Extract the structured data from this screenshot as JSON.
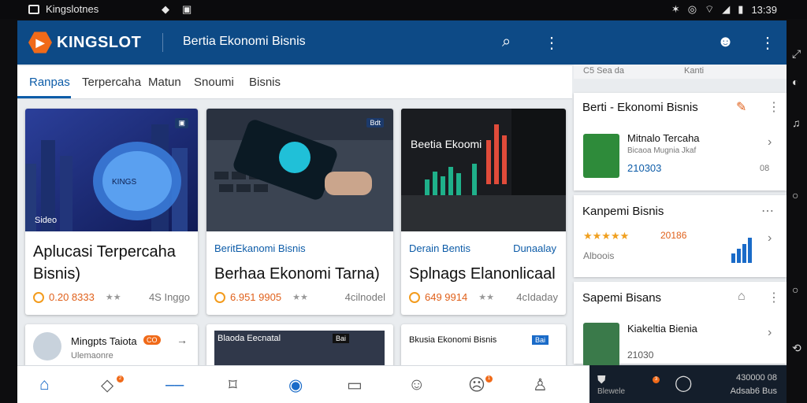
{
  "status_bar": {
    "app_name": "Kingslotnes",
    "time": "13:39",
    "icons": [
      "notification-icon",
      "bluetooth-icon",
      "alarm-icon",
      "wifi-icon",
      "signal-icon",
      "battery-icon"
    ]
  },
  "app_bar": {
    "logo": "KINGSLOT",
    "title": "Bertia Ekonomi Bisnis",
    "icons": [
      "search-icon",
      "more-vert-icon",
      "user-icon",
      "more-vert-icon"
    ]
  },
  "tabs": [
    {
      "label": "Ranpas",
      "active": true
    },
    {
      "label": "Terpercaha",
      "active": false
    },
    {
      "label": "Matun",
      "active": false
    },
    {
      "label": "Snoumi",
      "active": false
    },
    {
      "label": "Bisnis",
      "active": false
    }
  ],
  "cards": [
    {
      "badge": "",
      "image_label": "Sideo",
      "image_text": "KINGS",
      "category": "",
      "category_right": "",
      "title": "Aplucasi Terpercaha Bisnis)",
      "value": "0.20 8333",
      "right": "4S Inggo"
    },
    {
      "badge": "Bdt",
      "category": "BeritEkanomi Bisnis",
      "category_right": "",
      "title": "Berhaa Ekonomi Tarna)",
      "value": "6.951 9905",
      "right": "4cilnodel"
    },
    {
      "badge": "",
      "image_title": "Beetia Ekoomi",
      "category": "Derain Bentis",
      "category_right": "Dunaalay",
      "title": "Splnags Elanonlicaal",
      "value": "649 9914",
      "right": "4cIdaday"
    }
  ],
  "row2": [
    {
      "title": "Mingpts Taiota",
      "subtitle": "Ulemaonre",
      "badge": "CO"
    },
    {
      "title": "Blaoda Eecnatal",
      "badge": "Bai"
    },
    {
      "title": "Bkusia Ekonomi Bisnis",
      "badge": "Bai"
    }
  ],
  "side": {
    "top_row": {
      "left": "C5 Sea da",
      "right": "Kanti"
    },
    "card1": {
      "title": "Berti - Ekonomi Bisnis",
      "item_title": "Mitnalo Tercaha",
      "item_sub": "Bicaoa Mugnia Jkaf",
      "code": "210303",
      "right": "08"
    },
    "card2": {
      "title": "Kanpemi Bisnis",
      "rating": "20186",
      "sub": "Alboois"
    },
    "card3": {
      "title": "Sapemi Bisans",
      "item_title": "Kiakeltia Bienia",
      "code": "21030"
    }
  },
  "bottom_nav": [
    {
      "name": "home-icon"
    },
    {
      "name": "tag-icon",
      "badge": "2"
    },
    {
      "name": "minus-icon"
    },
    {
      "name": "bookmark-icon"
    },
    {
      "name": "globe-icon"
    },
    {
      "name": "mail-icon"
    },
    {
      "name": "emoji-icon"
    },
    {
      "name": "chat-bubble-icon",
      "badge": "1"
    },
    {
      "name": "person-icon"
    }
  ],
  "dark_panel": {
    "left": "Blewele",
    "badge": "3",
    "right_line1": "430000 08",
    "right_line2": "Adsab6 Bus"
  },
  "colors": {
    "app_bar": "#0d4a86",
    "accent": "#0d5ca8",
    "orange": "#f06a19"
  }
}
